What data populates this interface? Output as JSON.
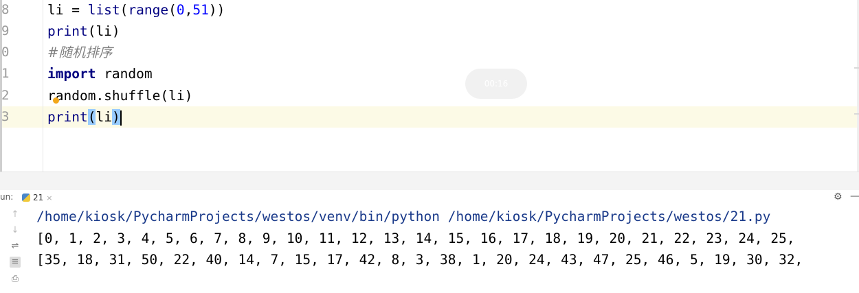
{
  "editor": {
    "line_numbers": [
      "8",
      "9",
      "0",
      "1",
      "2",
      "3"
    ],
    "lines": {
      "l8": {
        "a": "li = ",
        "fn": "list",
        "b": "(",
        "fn2": "range",
        "c": "(",
        "n1": "0",
        "d": ",",
        "n2": "51",
        "e": "))"
      },
      "l9": {
        "fn": "print",
        "rest": "(li)"
      },
      "l10": {
        "comment": "#随机排序"
      },
      "l11": {
        "kw": "import",
        "rest": " random"
      },
      "l12": {
        "text": "random.shuffle(li)"
      },
      "l13": {
        "fn": "print",
        "open": "(",
        "arg": "li",
        "close": ")"
      }
    },
    "overlay_text": "00:16"
  },
  "run_panel": {
    "label": "un:",
    "tab_name": "21",
    "tab_close": "×",
    "toolbar_icons": [
      "arrow-up-icon",
      "arrow-down-icon",
      "soft-wrap-icon",
      "scroll-to-end-icon",
      "print-icon"
    ]
  },
  "console": {
    "command": "/home/kiosk/PycharmProjects/westos/venv/bin/python /home/kiosk/PycharmProjects/westos/21.py",
    "output_1": "[0, 1, 2, 3, 4, 5, 6, 7, 8, 9, 10, 11, 12, 13, 14, 15, 16, 17, 18, 19, 20, 21, 22, 23, 24, 25,",
    "output_2": "[35, 18, 31, 50, 22, 40, 14, 7, 15, 17, 42, 8, 3, 38, 1, 20, 24, 43, 47, 25, 46, 5, 19, 30, 32,"
  },
  "colors": {
    "current_line": "#fcfae6",
    "paren_highlight": "#99ccff",
    "keyword": "#000080",
    "number": "#0000ff",
    "comment": "#808080"
  }
}
